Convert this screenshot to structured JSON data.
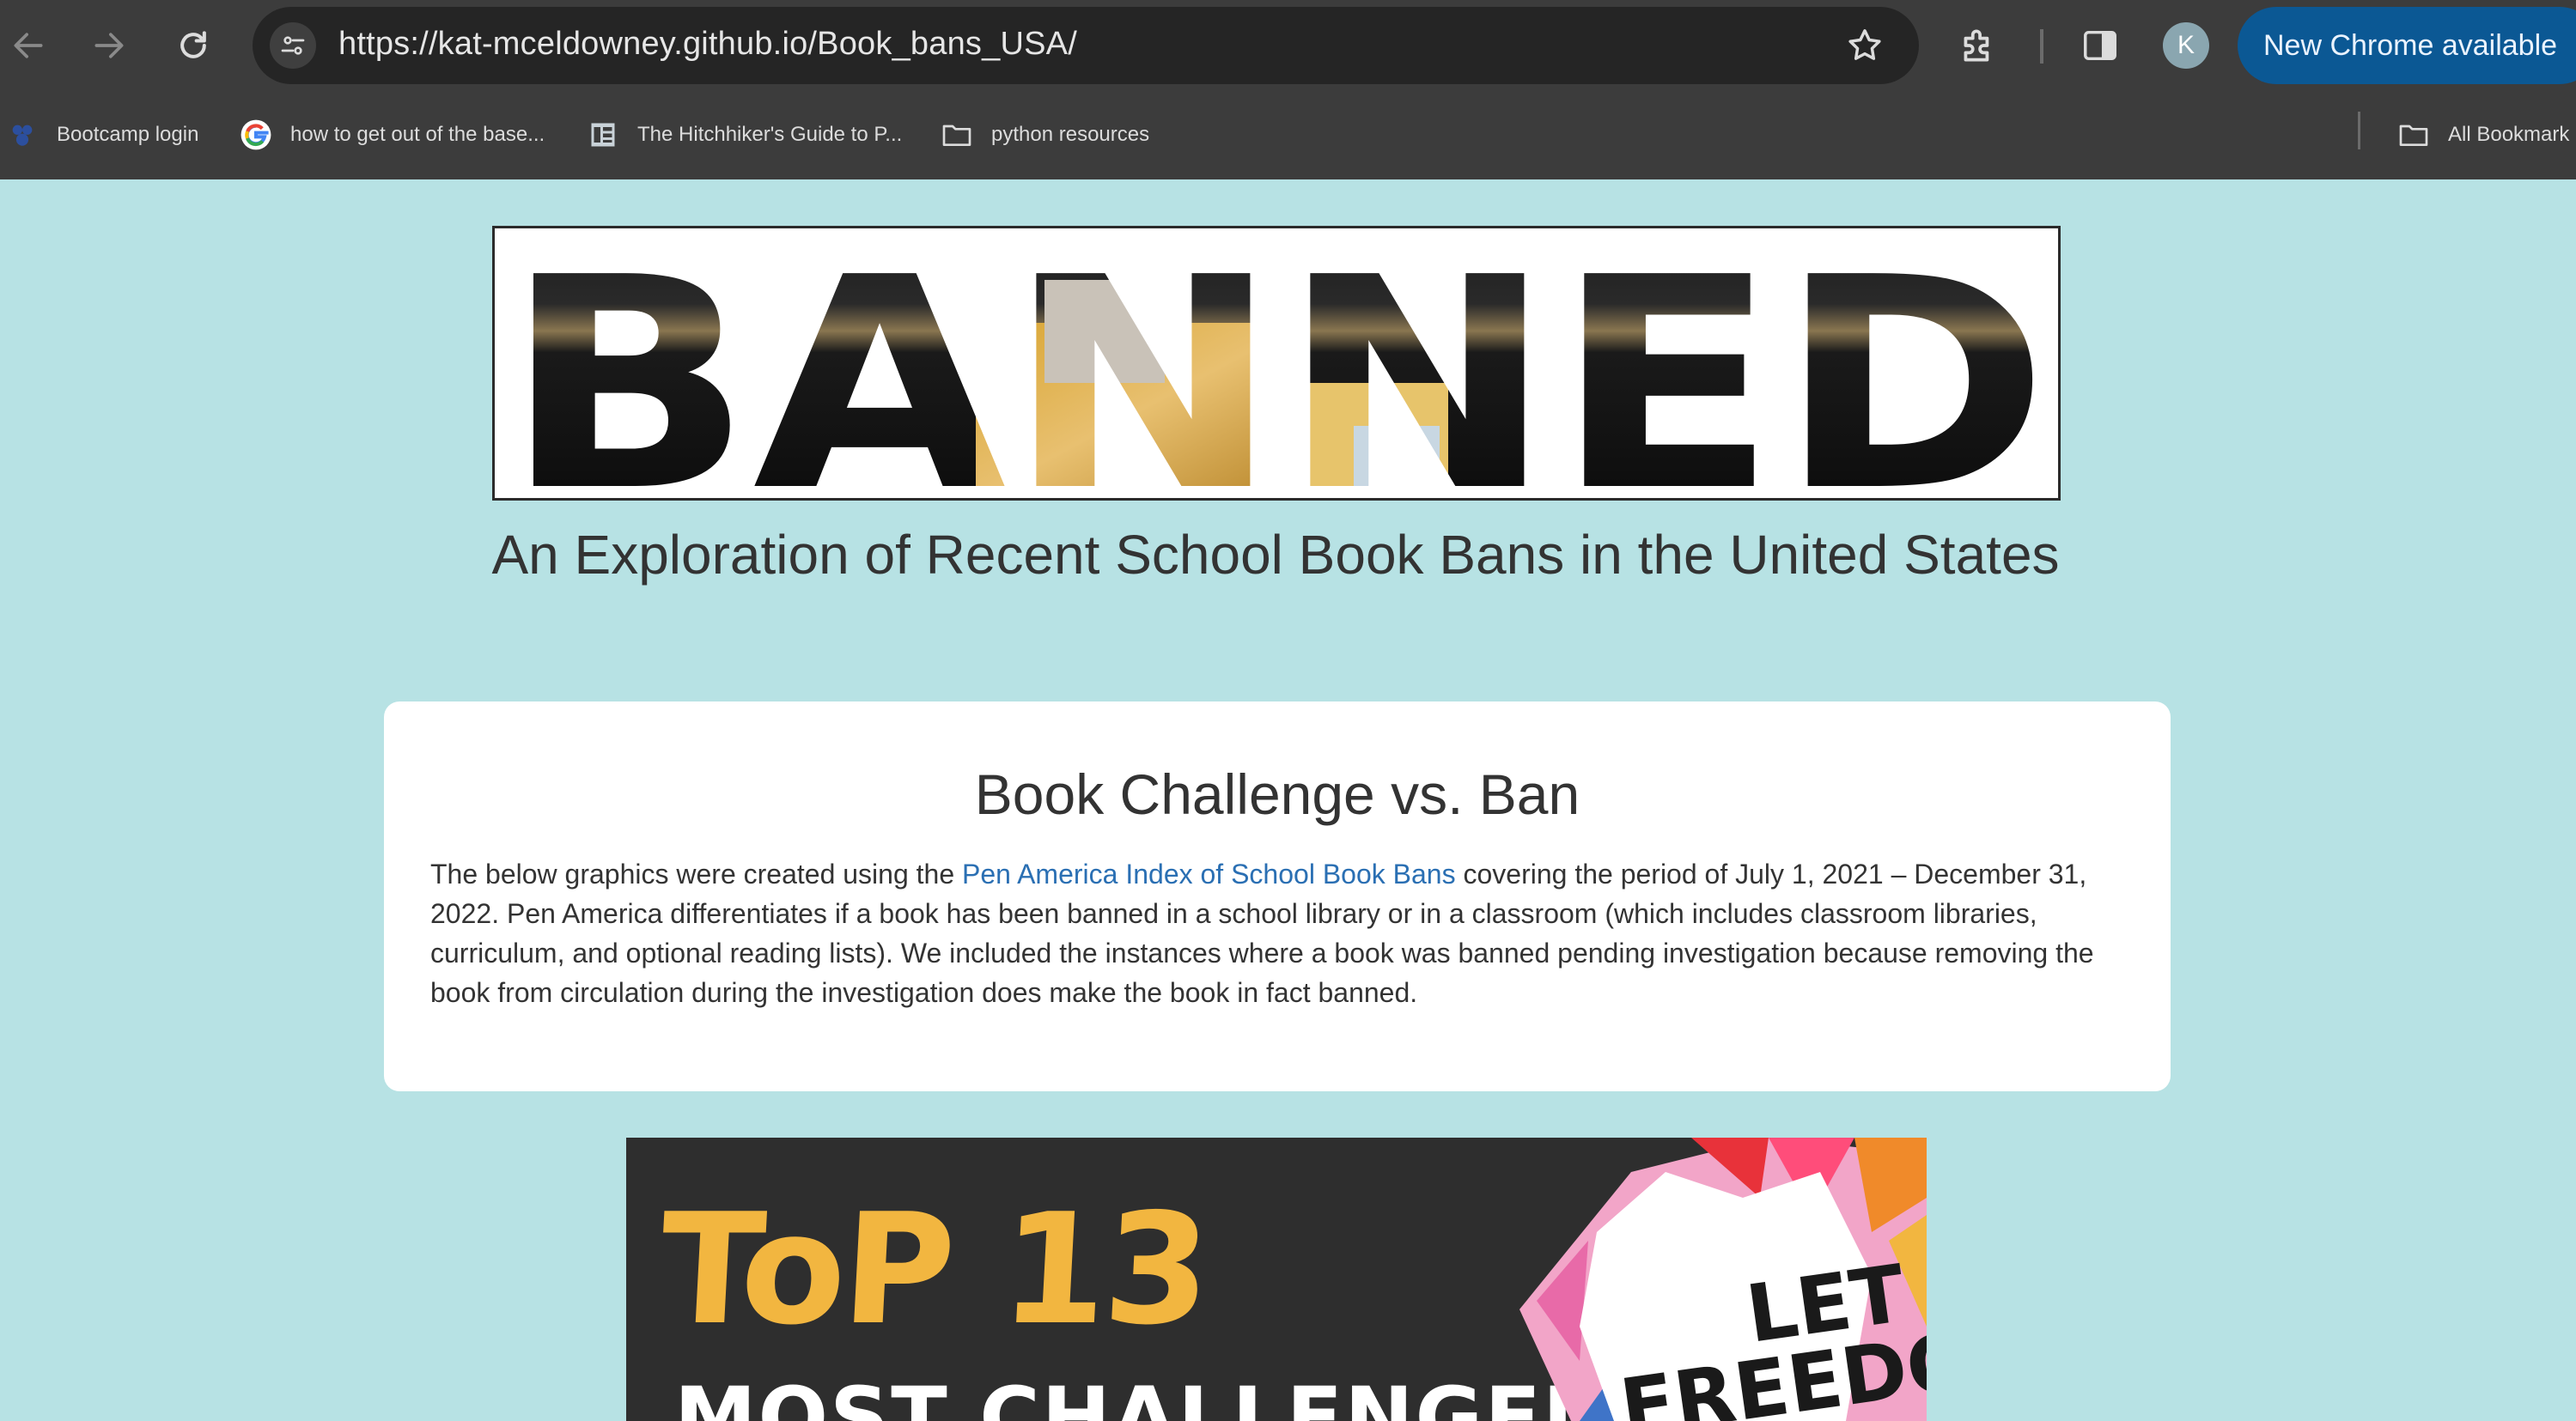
{
  "browser": {
    "url": "https://kat-mceldowney.github.io/Book_bans_USA/",
    "profile_initial": "K",
    "update_label": "New Chrome available",
    "bookmarks": [
      {
        "label": "Bootcamp login",
        "icon": "bootcamp-icon"
      },
      {
        "label": "how to get out of the base...",
        "icon": "google-icon"
      },
      {
        "label": "The Hitchhiker's Guide to P...",
        "icon": "book-icon"
      },
      {
        "label": "python resources",
        "icon": "folder-icon"
      }
    ],
    "all_bookmarks_label": "All Bookmark"
  },
  "header": {
    "banner_text": "BANNED",
    "subtitle": "An Exploration of Recent School Book Bans in the United States"
  },
  "card": {
    "title": "Book Challenge vs. Ban",
    "intro_before_link": "The below graphics were created using the ",
    "link_text": "Pen America Index of School Book Bans",
    "intro_after_link": " covering the period of July 1, 2021 – December 31, 2022. Pen America differentiates if a book has been banned in a school library or in a classroom (which includes classroom libraries, curriculum, and optional reading lists). We included the instances where a book was banned pending investigation because removing the book from circulation during the investigation does make the book in fact banned."
  },
  "poster": {
    "headline": "ToP 13",
    "subhead": "MOST CHALLENGED",
    "art_text": "LET FREEDOM",
    "colors": {
      "background": "#2e2e2e",
      "headline": "#f2b640"
    }
  },
  "colors": {
    "page_background": "#b7e2e4",
    "chrome_background": "#3c3c3c",
    "update_button": "#0b5894",
    "link": "#2a6fb3"
  }
}
